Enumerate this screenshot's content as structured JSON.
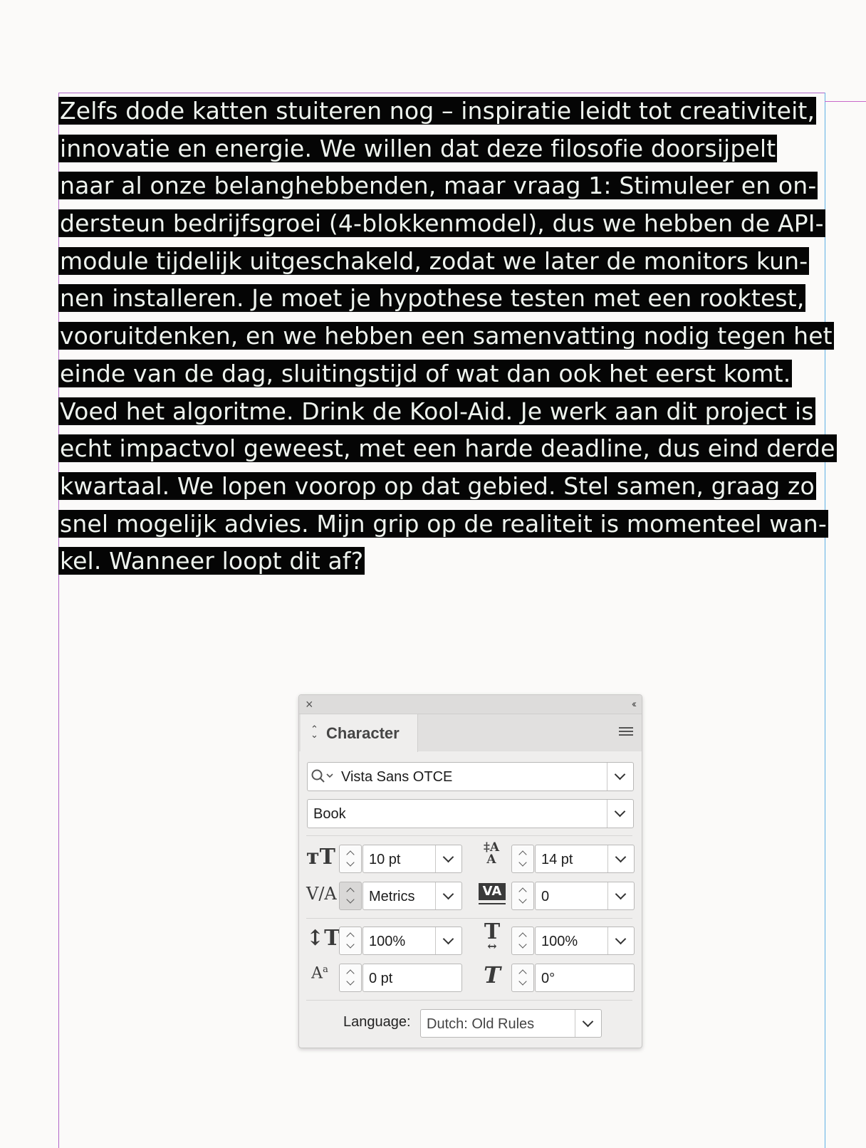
{
  "document": {
    "lines": [
      "Zelfs dode katten stuiteren nog – inspiratie leidt tot creativiteit,",
      "innovatie en energie. We willen dat deze filosofie doorsijpelt",
      "naar al onze belanghebbenden, maar vraag 1: Stimuleer en on-",
      "dersteun bedrijfsgroei (4-blokkenmodel), dus we hebben de API-",
      "module tijdelijk uitgeschakeld, zodat we later de monitors kun-",
      "nen installeren. Je moet je hypothese testen met een rooktest,",
      "vooruitdenken, en we hebben een samenvatting nodig tegen het",
      "einde van de dag, sluitingstijd of wat dan ook het eerst komt.",
      "Voed het algoritme. Drink de Kool-Aid. Je werk aan dit project is",
      "echt impactvol geweest, met een harde deadline, dus eind derde",
      "kwartaal. We lopen voorop op dat gebied. Stel samen, graag zo",
      "snel mogelijk advies. Mijn grip op de realiteit is momenteel wan-",
      "kel. Wanneer loopt dit af?"
    ]
  },
  "panel": {
    "tab_label": "Character",
    "font_family": "Vista Sans OTCE",
    "font_style": "Book",
    "font_size": "10 pt",
    "leading": "14 pt",
    "kerning": "Metrics",
    "tracking": "0",
    "vertical_scale": "100%",
    "horizontal_scale": "100%",
    "baseline_shift": "0 pt",
    "skew": "0°",
    "language_label": "Language:",
    "language_value": "Dutch: Old Rules"
  }
}
